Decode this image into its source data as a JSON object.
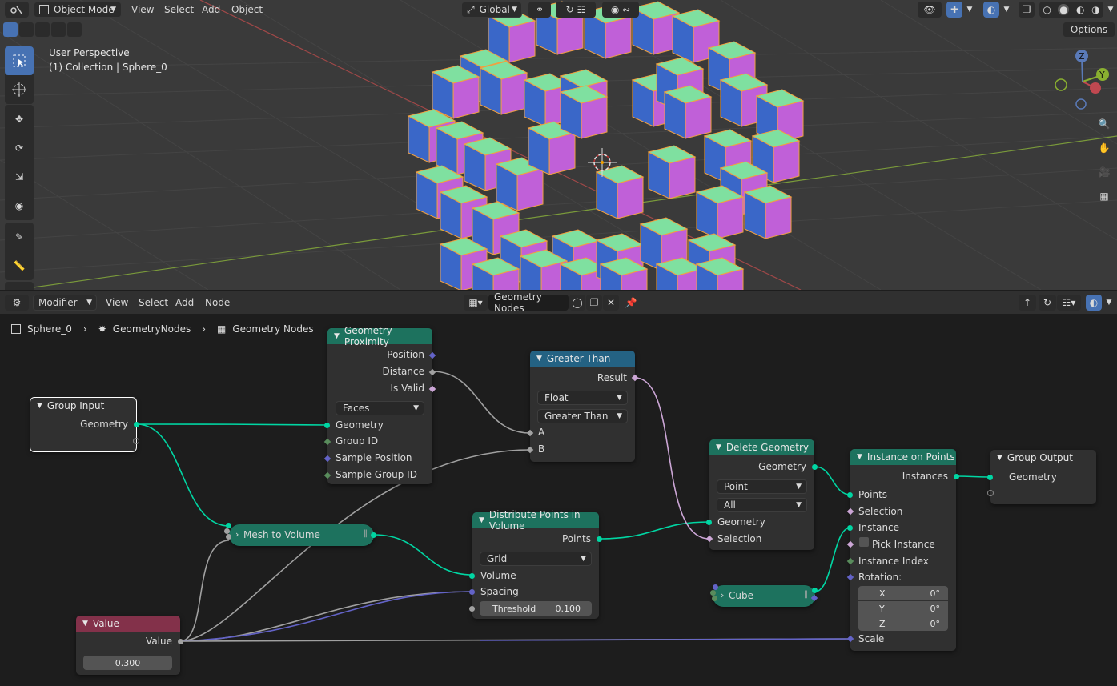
{
  "viewport": {
    "mode_label": "Object Mode",
    "menus": [
      "View",
      "Select",
      "Add",
      "Object"
    ],
    "transform_orientation": "Global",
    "options_label": "Options",
    "perspective_label": "User Perspective",
    "collection_label": "(1) Collection | Sphere_0",
    "axes": {
      "z": "Z",
      "y": "Y"
    }
  },
  "node_editor": {
    "editor_type_label": "Modifier",
    "menus": [
      "View",
      "Select",
      "Add",
      "Node"
    ],
    "tree_name": "Geometry Nodes",
    "breadcrumb": [
      "Sphere_0",
      "GeometryNodes",
      "Geometry Nodes"
    ],
    "nodes": {
      "group_input": {
        "title": "Group Input",
        "out_geometry": "Geometry"
      },
      "geometry_proximity": {
        "title": "Geometry Proximity",
        "out_position": "Position",
        "out_distance": "Distance",
        "out_is_valid": "Is Valid",
        "mode": "Faces",
        "in_geometry": "Geometry",
        "in_group_id": "Group ID",
        "in_sample_position": "Sample Position",
        "in_sample_group_id": "Sample Group ID"
      },
      "greater_than": {
        "title": "Greater Than",
        "out_result": "Result",
        "data_type": "Float",
        "operation": "Greater Than",
        "in_a": "A",
        "in_b": "B"
      },
      "delete_geometry": {
        "title": "Delete Geometry",
        "out_geometry": "Geometry",
        "domain": "Point",
        "mode": "All",
        "in_geometry": "Geometry",
        "in_selection": "Selection"
      },
      "instance_on_points": {
        "title": "Instance on Points",
        "out_instances": "Instances",
        "in_points": "Points",
        "in_selection": "Selection",
        "in_instance": "Instance",
        "pick_instance": "Pick Instance",
        "in_instance_index": "Instance Index",
        "in_rotation": "Rotation:",
        "rot_x_label": "X",
        "rot_x": "0°",
        "rot_y_label": "Y",
        "rot_y": "0°",
        "rot_z_label": "Z",
        "rot_z": "0°",
        "in_scale": "Scale"
      },
      "group_output": {
        "title": "Group Output",
        "in_geometry": "Geometry"
      },
      "mesh_to_volume": {
        "title": "Mesh to Volume"
      },
      "distribute_points": {
        "title": "Distribute Points in Volume",
        "out_points": "Points",
        "mode": "Grid",
        "in_volume": "Volume",
        "in_spacing": "Spacing",
        "threshold_label": "Threshold",
        "threshold_value": "0.100"
      },
      "cube": {
        "title": "Cube"
      },
      "value": {
        "title": "Value",
        "out_value": "Value",
        "value": "0.300"
      }
    }
  },
  "colors": {
    "geometry_header": "#1d725e",
    "vector_header": "#3c3c83",
    "converter_header": "#246283",
    "input_header": "#83314a",
    "selection_blue": "#4772b3"
  }
}
